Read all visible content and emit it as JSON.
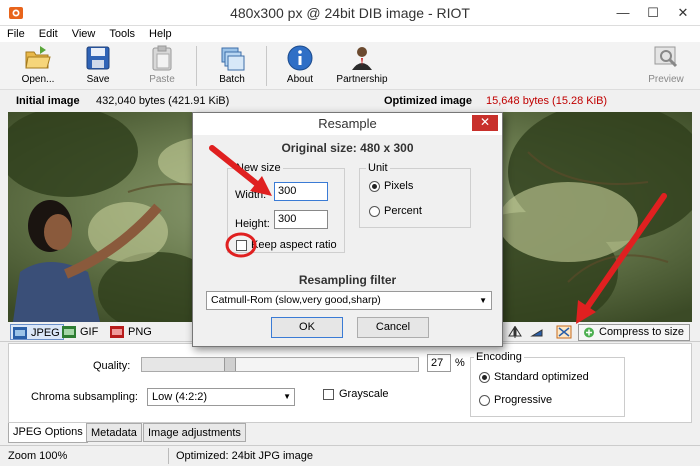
{
  "window": {
    "title": "480x300 px @ 24bit DIB image - RIOT",
    "app_icon": "riot-app-icon"
  },
  "menu": [
    "File",
    "Edit",
    "View",
    "Tools",
    "Help"
  ],
  "toolbar": {
    "open": "Open...",
    "save": "Save",
    "paste": "Paste",
    "batch": "Batch",
    "about": "About",
    "partnership": "Partnership",
    "preview": "Preview"
  },
  "sizes": {
    "initial_label": "Initial image",
    "initial_value": "432,040 bytes (421.91 KiB)",
    "optimized_label": "Optimized image",
    "optimized_value": "15,648 bytes (15.28 KiB)",
    "optimized_color": "#c00000"
  },
  "formats": {
    "jpeg": "JPEG",
    "gif": "GIF",
    "png": "PNG",
    "compress": "Compress to size"
  },
  "options": {
    "quality_label": "Quality:",
    "quality_value": "27",
    "quality_unit": "%",
    "quality_fraction": 0.27,
    "chroma_label": "Chroma subsampling:",
    "chroma_value": "Low (4:2:2)",
    "grayscale_label": "Grayscale",
    "encoding_label": "Encoding",
    "encoding_standard": "Standard optimized",
    "encoding_progressive": "Progressive"
  },
  "tabs": [
    "JPEG Options",
    "Metadata",
    "Image adjustments"
  ],
  "status": {
    "zoom": "Zoom 100%",
    "info": "Optimized: 24bit JPG image"
  },
  "dialog": {
    "title": "Resample",
    "close": "✕",
    "original_size": "Original size: 480 x 300",
    "new_size_label": "New size",
    "width_label": "Width:",
    "width_value": "300",
    "height_label": "Height:",
    "height_value": "300",
    "keep_aspect": "Keep aspect ratio",
    "unit_label": "Unit",
    "unit_pixels": "Pixels",
    "unit_percent": "Percent",
    "filter_label": "Resampling filter",
    "filter_value": "Catmull-Rom (slow,very good,sharp)",
    "ok": "OK",
    "cancel": "Cancel"
  },
  "colors": {
    "annotation_red": "#e02020",
    "accent_blue": "#3a7bd5"
  }
}
